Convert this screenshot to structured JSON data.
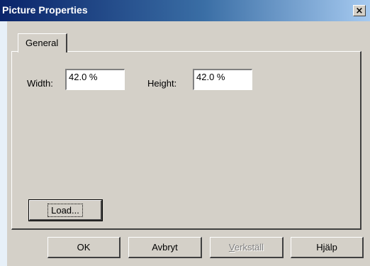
{
  "window": {
    "title": "Picture Properties",
    "close_label": "×"
  },
  "tabs": [
    {
      "label": "General",
      "selected": true
    }
  ],
  "form": {
    "width_label": "Width:",
    "width_value": "42.0 %",
    "height_label": "Height:",
    "height_value": "42.0 %",
    "load_label": "Load..."
  },
  "buttons": {
    "ok": "OK",
    "cancel": "Avbryt",
    "apply_first": "V",
    "apply_rest": "erkställ",
    "help": "Hjälp"
  },
  "colors": {
    "title_gradient_start": "#0a246a",
    "title_gradient_end": "#a6caf0",
    "face": "#d4d0c8"
  }
}
